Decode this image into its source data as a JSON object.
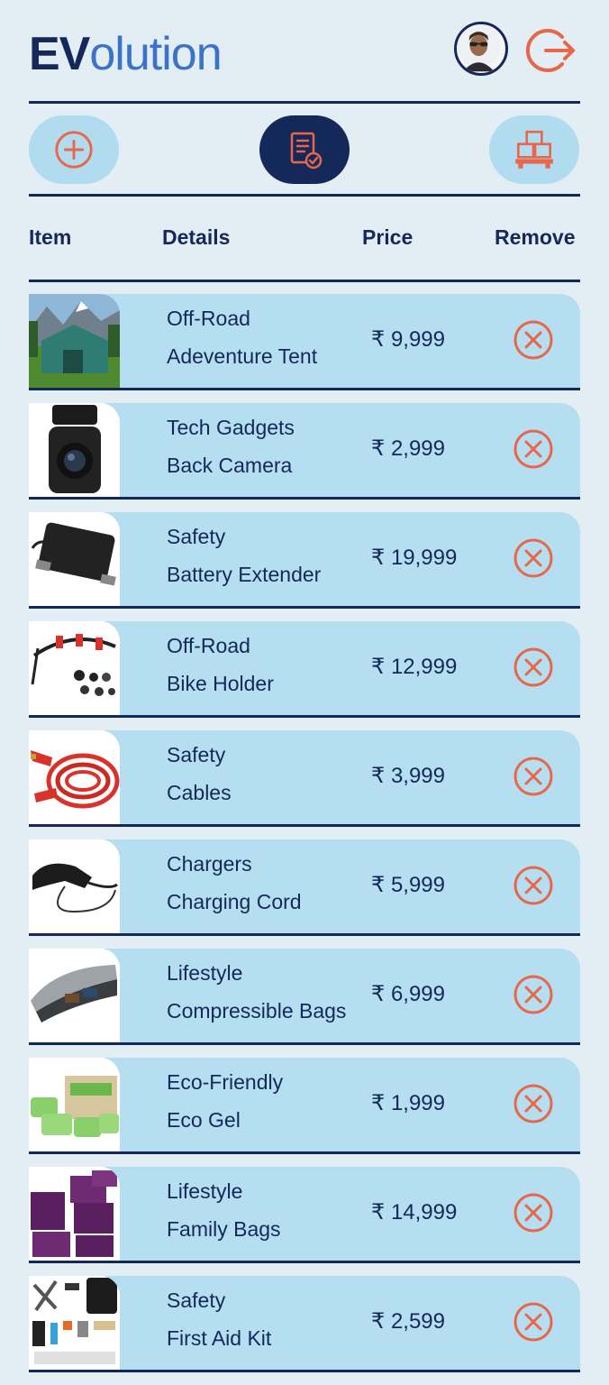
{
  "app": {
    "logo_bold": "EV",
    "logo_rest": "olution"
  },
  "columns": {
    "item": "Item",
    "details": "Details",
    "price": "Price",
    "remove": "Remove"
  },
  "nav": [
    {
      "name": "add",
      "active": false
    },
    {
      "name": "orders",
      "active": true
    },
    {
      "name": "products",
      "active": false
    }
  ],
  "cart_items": [
    {
      "category": "Off-Road",
      "name": "Adeventure Tent",
      "price": "₹ 9,999",
      "image": "tent"
    },
    {
      "category": "Tech Gadgets",
      "name": "Back Camera",
      "price": "₹ 2,999",
      "image": "camera"
    },
    {
      "category": "Safety",
      "name": "Battery Extender",
      "price": "₹ 19,999",
      "image": "battery"
    },
    {
      "category": "Off-Road",
      "name": "Bike Holder",
      "price": "₹ 12,999",
      "image": "bike-holder"
    },
    {
      "category": "Safety",
      "name": "Cables",
      "price": "₹ 3,999",
      "image": "cables"
    },
    {
      "category": "Chargers",
      "name": "Charging Cord",
      "price": "₹ 5,999",
      "image": "charging-cord"
    },
    {
      "category": "Lifestyle",
      "name": "Compressible Bags",
      "price": "₹ 6,999",
      "image": "roof-box"
    },
    {
      "category": "Eco-Friendly",
      "name": "Eco Gel",
      "price": "₹ 1,999",
      "image": "eco-gel"
    },
    {
      "category": "Lifestyle",
      "name": "Family Bags",
      "price": "₹ 14,999",
      "image": "family-bags"
    },
    {
      "category": "Safety",
      "name": "First Aid Kit",
      "price": "₹ 2,599",
      "image": "first-aid-kit"
    }
  ],
  "colors": {
    "navy": "#14285a",
    "accent": "#e8664a",
    "row_bg": "#b5dff0",
    "page_bg": "#e3edf4"
  }
}
